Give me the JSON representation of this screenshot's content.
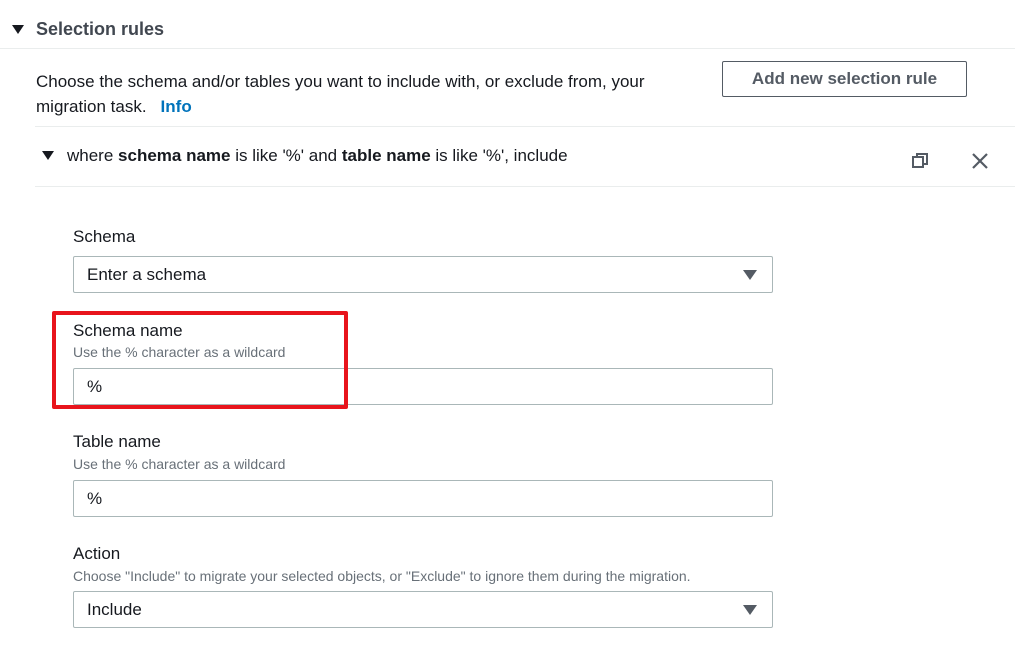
{
  "section": {
    "title": "Selection rules",
    "description_line1": "Choose the schema and/or tables you want to include with, or exclude from, your",
    "description_line2": "migration task.",
    "info_link": "Info",
    "add_button": "Add new selection rule"
  },
  "rule": {
    "summary_prefix": "where ",
    "summary_schema": "schema name",
    "summary_mid1": " is like '%' and ",
    "summary_table": "table name",
    "summary_mid2": " is like '%', include",
    "copy_icon": "copy-icon",
    "close_icon": "close-icon"
  },
  "form": {
    "schema": {
      "label": "Schema",
      "value": "Enter a schema"
    },
    "schema_name": {
      "label": "Schema name",
      "hint": "Use the % character as a wildcard",
      "value": "%"
    },
    "table_name": {
      "label": "Table name",
      "hint": "Use the % character as a wildcard",
      "value": "%"
    },
    "action": {
      "label": "Action",
      "hint": "Choose \"Include\" to migrate your selected objects, or \"Exclude\" to ignore them during the migration.",
      "value": "Include"
    }
  },
  "colors": {
    "link": "#0073bb",
    "highlight": "#e8141c",
    "border": "#aab7b8"
  }
}
